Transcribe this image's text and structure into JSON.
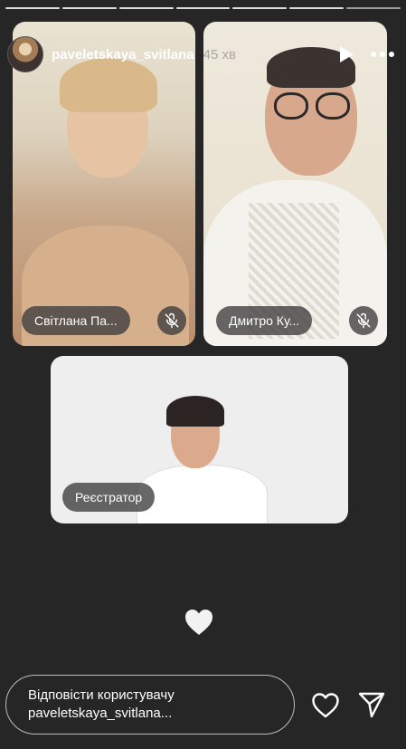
{
  "story": {
    "segments": 7,
    "user": {
      "username": "paveletskaya_svitlana",
      "time": "45 хв"
    },
    "icons": {
      "play": "play-icon",
      "more": "more-dots-icon",
      "heart_float": "heart-icon",
      "like": "heart-outline-icon",
      "send": "send-icon",
      "mic": "mic-off-icon"
    }
  },
  "participants": [
    {
      "name": "Світлана Па...",
      "muted": true
    },
    {
      "name": "Дмитро Ку...",
      "muted": true
    },
    {
      "name": "Реєстратор",
      "muted": false
    }
  ],
  "reply": {
    "placeholder": "Відповісти користувачу paveletskaya_svitlana..."
  },
  "colors": {
    "background": "#262626",
    "pill": "#3c3c3c",
    "time": "#a8a8a8"
  }
}
